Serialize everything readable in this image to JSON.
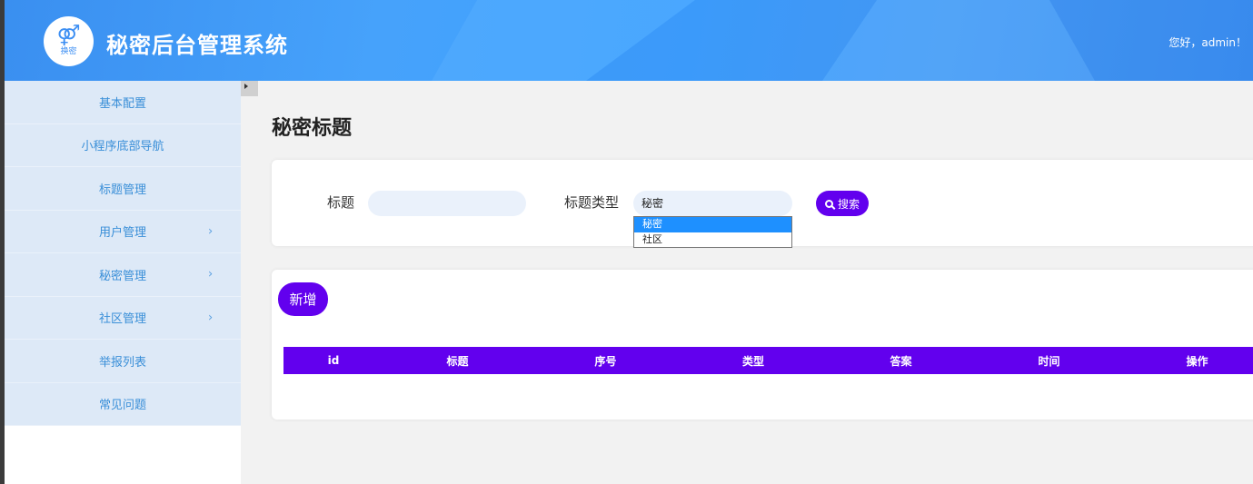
{
  "header": {
    "logo_symbol": "⚤",
    "logo_text": "换密",
    "title": "秘密后台管理系统",
    "greeting": "您好，admin！",
    "accent": "#3f9cf8"
  },
  "sidebar": {
    "items": [
      {
        "label": "基本配置",
        "has_children": false
      },
      {
        "label": "小程序底部导航",
        "has_children": false
      },
      {
        "label": "标题管理",
        "has_children": false
      },
      {
        "label": "用户管理",
        "has_children": true
      },
      {
        "label": "秘密管理",
        "has_children": true
      },
      {
        "label": "社区管理",
        "has_children": true
      },
      {
        "label": "举报列表",
        "has_children": false
      },
      {
        "label": "常见问题",
        "has_children": false
      }
    ],
    "chevron": "›"
  },
  "main": {
    "page_title": "秘密标题",
    "search": {
      "title_label": "标题",
      "title_value": "",
      "type_label": "标题类型",
      "type_value": "秘密",
      "type_options": [
        "秘密",
        "社区"
      ],
      "type_selected_index": 0,
      "search_button": "搜索"
    },
    "add_button": "新增",
    "table": {
      "columns": [
        "id",
        "标题",
        "序号",
        "类型",
        "答案",
        "时间",
        "操作"
      ],
      "header_color": "#6200ee",
      "rows": []
    }
  }
}
